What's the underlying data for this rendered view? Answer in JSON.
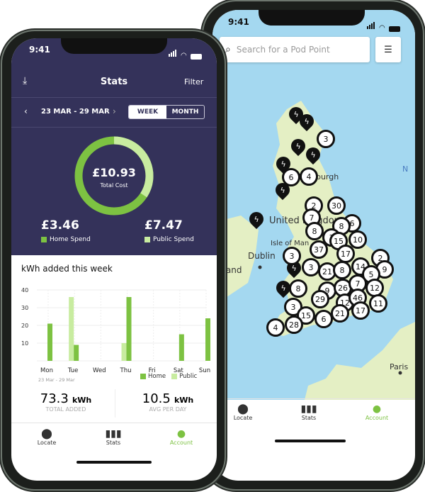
{
  "colors": {
    "navy": "#34325a",
    "home_green": "#7dc242",
    "public_green": "#c8eca0",
    "map_water": "#a4d8f0",
    "map_land": "#e4efc4",
    "accent": "#7dc242"
  },
  "map_phone": {
    "status_time": "9:41",
    "search_placeholder": "Search for a Pod Point",
    "labels": {
      "dublin": "Dublin",
      "isle_of_man": "Isle of Man",
      "ireland": "Ireland",
      "paris": "Paris",
      "north": "N",
      "edinburgh": "Edinburgh",
      "uk": "United Kingdom"
    },
    "clusters": [
      "3",
      "6",
      "4",
      "2",
      "30",
      "7",
      "8",
      "6",
      "8",
      "3",
      "15",
      "10",
      "37",
      "17",
      "3",
      "3",
      "21",
      "8",
      "14",
      "2",
      "9",
      "5",
      "8",
      "9",
      "26",
      "7",
      "12",
      "29",
      "12",
      "46",
      "11",
      "3",
      "15",
      "6",
      "21",
      "17",
      "4",
      "28"
    ],
    "nav": [
      {
        "label": "Locate",
        "icon": "map-pin-icon"
      },
      {
        "label": "Stats",
        "icon": "bar-chart-icon"
      },
      {
        "label": "Account",
        "icon": "person-icon",
        "active": true
      }
    ]
  },
  "stats_phone": {
    "status_time": "9:41",
    "title": "Stats",
    "filter": "Filter",
    "date_range": "23 MAR - 29 MAR",
    "toggle": {
      "week": "WEEK",
      "month": "MONTH",
      "selected": "WEEK"
    },
    "total_cost": "£10.93",
    "total_cost_label": "Total Cost",
    "home_spend": "£3.46",
    "home_spend_label": "Home Spend",
    "public_spend": "£7.47",
    "public_spend_label": "Public Spend",
    "chart_title": "kWh added this week",
    "date_caption": "23 Mar - 29 Mar",
    "total_added": "73.3",
    "total_added_unit": "kWh",
    "total_added_label": "TOTAL ADDED",
    "avg": "10.5",
    "avg_unit": "kWh",
    "avg_label": "AVG PER DAY",
    "nav": [
      {
        "label": "Locate",
        "icon": "map-pin-icon"
      },
      {
        "label": "Stats",
        "icon": "bar-chart-icon"
      },
      {
        "label": "Account",
        "icon": "person-icon",
        "active": true
      }
    ]
  },
  "chart_data": {
    "type": "bar",
    "categories": [
      "Mon",
      "Tue",
      "Wed",
      "Thu",
      "Fri",
      "Sat",
      "Sun"
    ],
    "series": [
      {
        "name": "Public",
        "values": [
          0,
          36,
          0,
          10,
          0,
          0,
          0
        ]
      },
      {
        "name": "Home",
        "values": [
          21,
          9,
          0,
          36,
          0,
          15,
          24
        ]
      }
    ],
    "yticks": [
      "10",
      "20",
      "30",
      "40"
    ],
    "ylim": [
      0,
      40
    ],
    "grid": true,
    "legend": "bottom-right",
    "donut": {
      "home": 3.46,
      "public": 7.47
    }
  }
}
